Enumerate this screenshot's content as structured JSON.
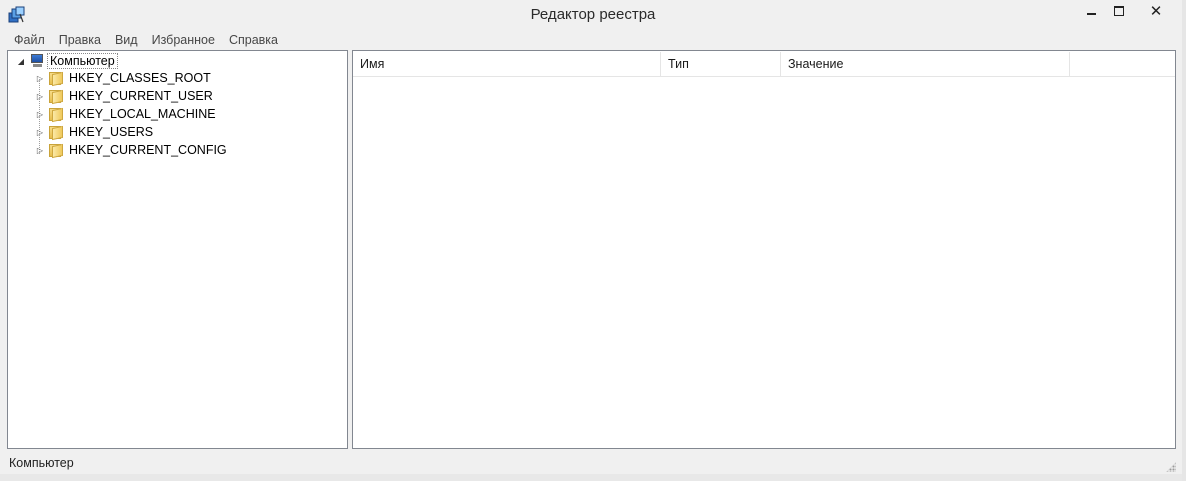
{
  "window": {
    "title": "Редактор реестра"
  },
  "menu": {
    "items": [
      "Файл",
      "Правка",
      "Вид",
      "Избранное",
      "Справка"
    ]
  },
  "tree": {
    "root": {
      "label": "Компьютер",
      "expander": "◢",
      "icon": "computer-icon"
    },
    "children": [
      {
        "label": "HKEY_CLASSES_ROOT",
        "expander": "▷",
        "icon": "folder-icon"
      },
      {
        "label": "HKEY_CURRENT_USER",
        "expander": "▷",
        "icon": "folder-icon"
      },
      {
        "label": "HKEY_LOCAL_MACHINE",
        "expander": "▷",
        "icon": "folder-icon"
      },
      {
        "label": "HKEY_USERS",
        "expander": "▷",
        "icon": "folder-icon"
      },
      {
        "label": "HKEY_CURRENT_CONFIG",
        "expander": "▷",
        "icon": "folder-icon"
      }
    ]
  },
  "list": {
    "columns": [
      "Имя",
      "Тип",
      "Значение"
    ]
  },
  "status": {
    "text": "Компьютер"
  },
  "glyphs": {
    "close": "✕"
  }
}
